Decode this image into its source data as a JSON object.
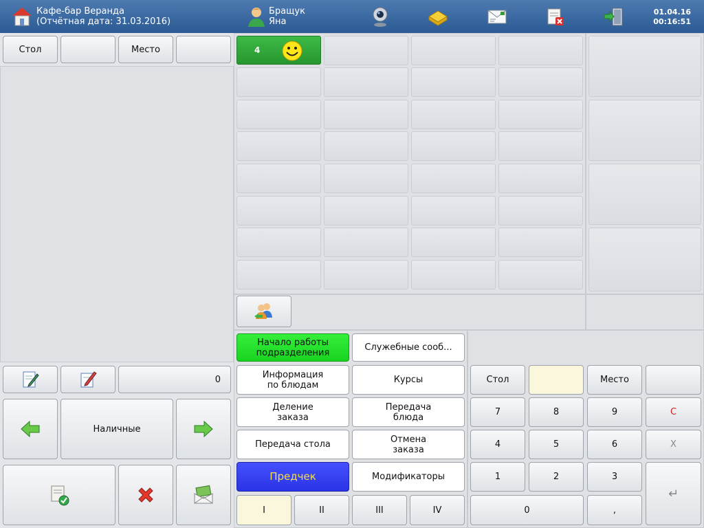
{
  "header": {
    "cafe_name": "Кафе-бар Веранда",
    "report_date": "(Отчётная дата: 31.03.2016)",
    "user_last_name": "Бращук",
    "user_first_name": "Яна",
    "date": "01.04.16",
    "time": "00:16:51",
    "icons": [
      "home-icon",
      "user-icon",
      "webcam-icon",
      "envelope-tray-icon",
      "message-icon",
      "close-order-icon",
      "exit-door-icon"
    ]
  },
  "left": {
    "table_label": "Стол",
    "table_value": "",
    "seat_label": "Место",
    "seat_value": "",
    "total_value": "0",
    "payment_label": "Наличные"
  },
  "tables": {
    "active_label": "4",
    "active_icon": "smiley-icon"
  },
  "actions": {
    "start_shift": "Начало работы\nподразделения",
    "service_messages": "Служебные сооб...",
    "dish_info": "Информация\nпо блюдам",
    "courses": "Курсы",
    "split_order": "Деление\nзаказа",
    "transfer_dish": "Передача\nблюда",
    "transfer_table": "Передача стола",
    "cancel_order": "Отмена\nзаказа",
    "precheck": "Предчек",
    "modifiers": "Модификаторы",
    "course_tabs": [
      "I",
      "II",
      "III",
      "IV"
    ]
  },
  "numpad": {
    "table_label": "Стол",
    "seat_label": "Место",
    "row1": [
      "7",
      "8",
      "9"
    ],
    "row2": [
      "4",
      "5",
      "6"
    ],
    "row3": [
      "1",
      "2",
      "3"
    ],
    "zero": "0",
    "comma": ",",
    "clear": "C",
    "multiply": "X",
    "enter": "↵"
  },
  "colors": {
    "header": "#2f5e98",
    "active_table": "#2fa63a",
    "start_shift": "#22e02a",
    "precheck_bg": "#3340f2",
    "precheck_text": "#f8e13a",
    "numpad_field": "#fbf7dc",
    "clear_text": "#d02020"
  }
}
